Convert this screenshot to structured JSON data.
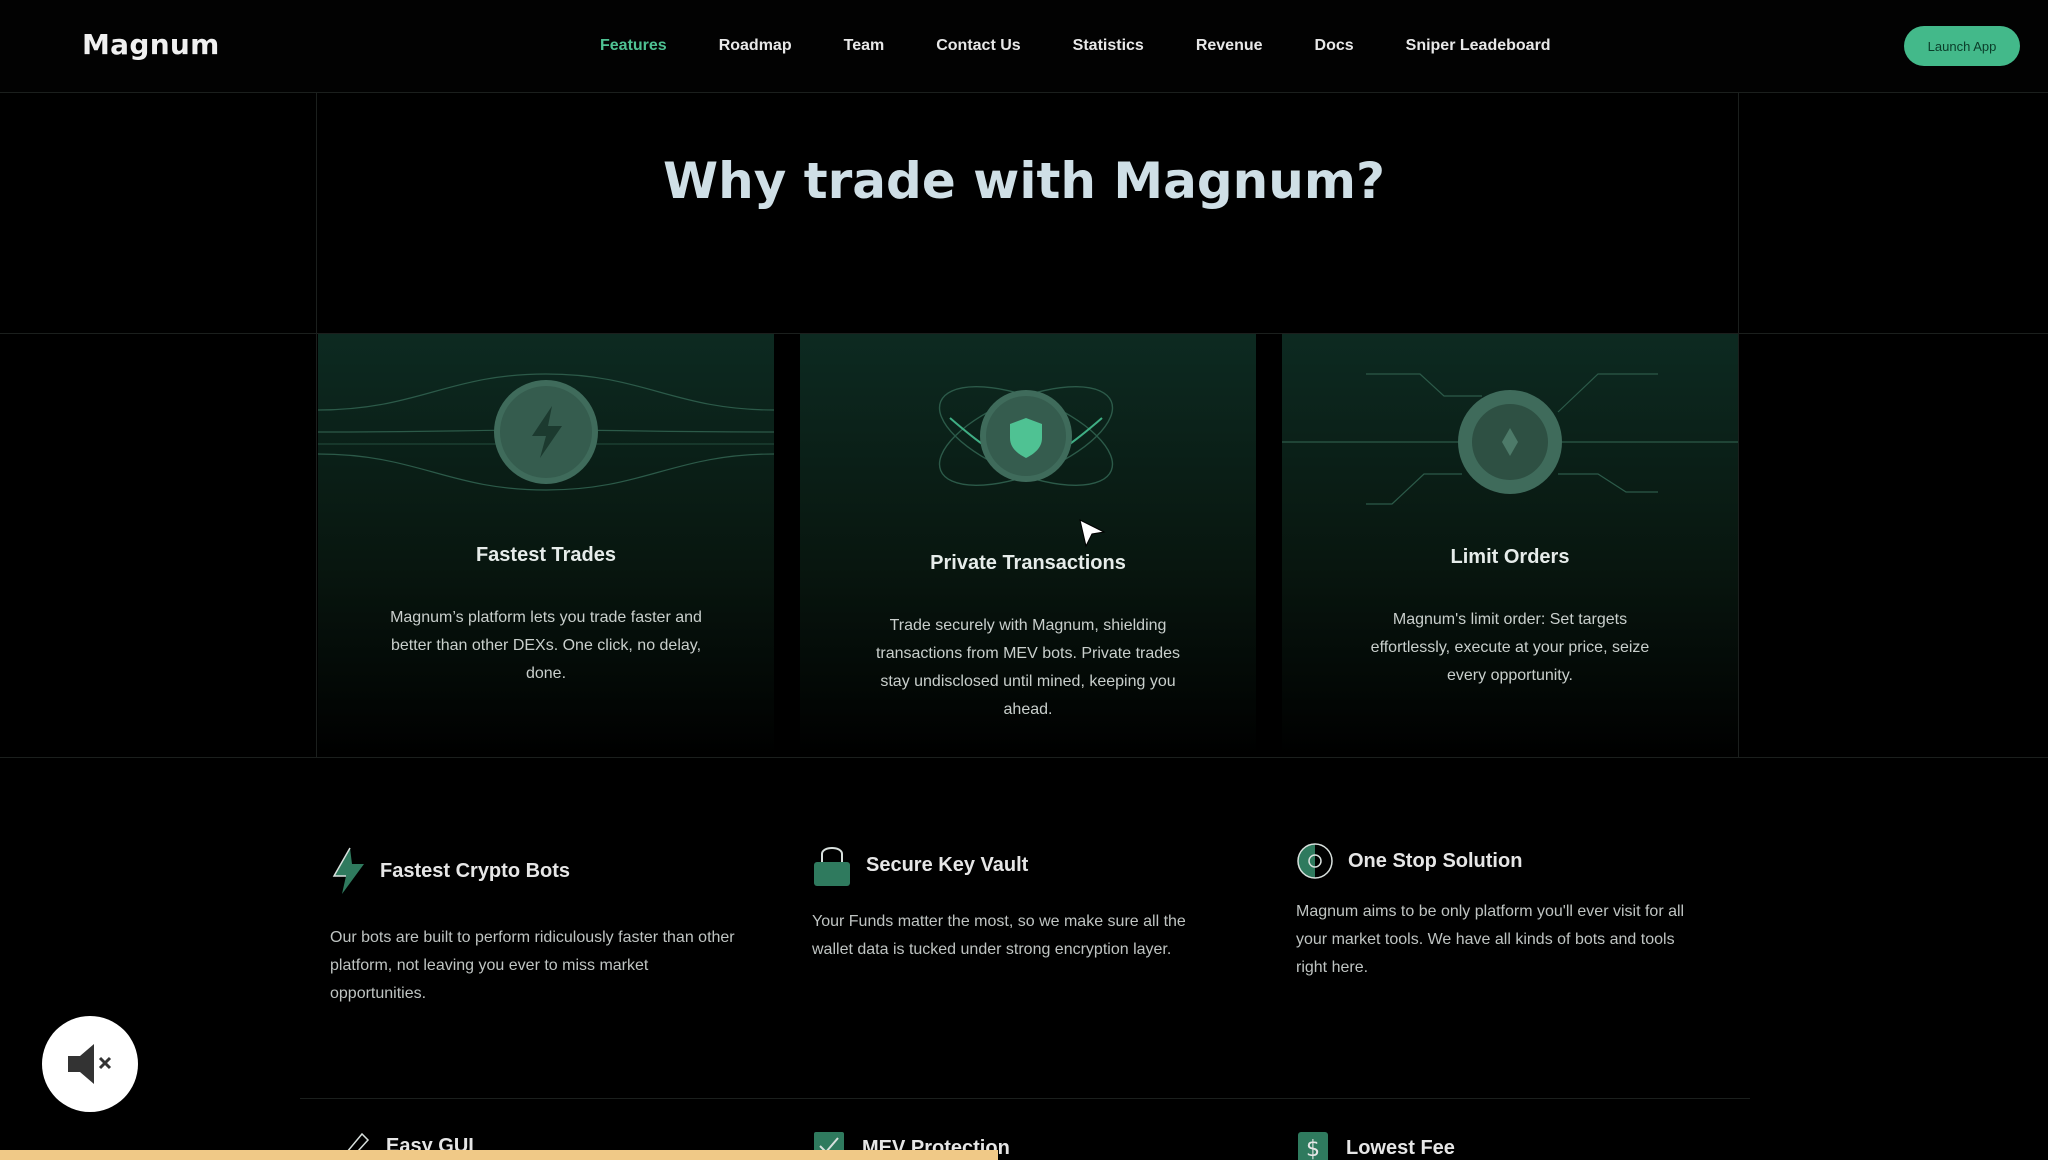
{
  "nav": {
    "brand": "Magnum",
    "links": [
      "Features",
      "Roadmap",
      "Team",
      "Contact Us",
      "Statistics",
      "Revenue",
      "Docs",
      "Sniper Leadeboard"
    ],
    "active": "Features",
    "launch_label": "Launch App"
  },
  "hero": {
    "title": "Why trade with Magnum?"
  },
  "cards": [
    {
      "title": "Fastest Trades",
      "desc": "Magnum’s platform lets you trade faster and better than other DEXs. One click, no delay, done.",
      "icon": "lightning-icon"
    },
    {
      "title": "Private Transactions",
      "desc": "Trade securely with Magnum, shielding transactions from MEV bots. Private trades stay undisclosed until mined, keeping you ahead.",
      "icon": "shield-icon"
    },
    {
      "title": "Limit Orders",
      "desc": "Magnum's limit order: Set targets effortlessly, execute at your price, seize every opportunity.",
      "icon": "diamond-icon"
    }
  ],
  "features": [
    {
      "title": "Fastest Crypto Bots",
      "desc": "Our bots are built to perform ridiculously faster than other platform, not leaving you ever to miss market opportunities.",
      "icon": "bolt-icon"
    },
    {
      "title": "Secure Key Vault",
      "desc": "Your Funds matter the most, so we make sure all the wallet data is tucked under strong encryption layer.",
      "icon": "lock-icon"
    },
    {
      "title": "One Stop Solution",
      "desc": "Magnum aims to be only platform you'll ever visit for all your market tools. We have all kinds of bots and tools right here.",
      "icon": "target-icon"
    }
  ],
  "features_row2": [
    {
      "title": "Easy GUI",
      "icon": "pen-icon"
    },
    {
      "title": "MEV Protection",
      "icon": "check-icon"
    },
    {
      "title": "Lowest Fee",
      "icon": "dollar-icon"
    }
  ],
  "overlay": {
    "mute_icon": "mute-icon"
  },
  "colors": {
    "accent": "#4fc293",
    "button": "#43b98a",
    "progress": "#f0c987"
  }
}
